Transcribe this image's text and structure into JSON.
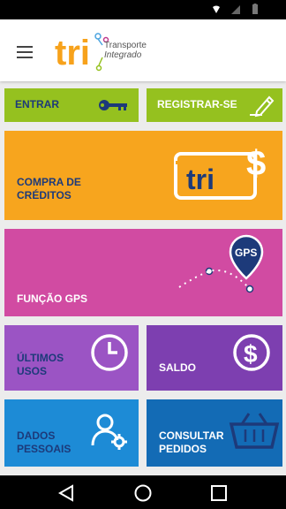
{
  "logo": {
    "mark": "tri",
    "line1": "Transporte",
    "line2": "Integrado"
  },
  "tiles": {
    "entrar": "ENTRAR",
    "registrar": "REGISTRAR-SE",
    "compra_line1": "COMPRA DE",
    "compra_line2": "CRÉDITOS",
    "compra_card_text": "tri",
    "gps": "FUNÇÃO GPS",
    "gps_pin_text": "GPS",
    "ultimos_line1": "ÚLTIMOS",
    "ultimos_line2": "USOS",
    "saldo": "SALDO",
    "dados_line1": "DADOS",
    "dados_line2": "PESSOAIS",
    "consultar_line1": "CONSULTAR",
    "consultar_line2": "PEDIDOS"
  },
  "colors": {
    "green": "#95c11f",
    "orange": "#f7a51e",
    "magenta": "#d14ba2",
    "purple_light": "#9b54c4",
    "purple_dark": "#7d3fb0",
    "blue": "#1d8bd6",
    "blue_dark": "#136bb5",
    "label": "#1d3a7a"
  },
  "icons": [
    "menu-icon",
    "key-icon",
    "pencil-icon",
    "tri-card-icon",
    "gps-pin-icon",
    "clock-icon",
    "dollar-icon",
    "user-gear-icon",
    "basket-icon",
    "back-icon",
    "home-icon",
    "recents-icon"
  ]
}
